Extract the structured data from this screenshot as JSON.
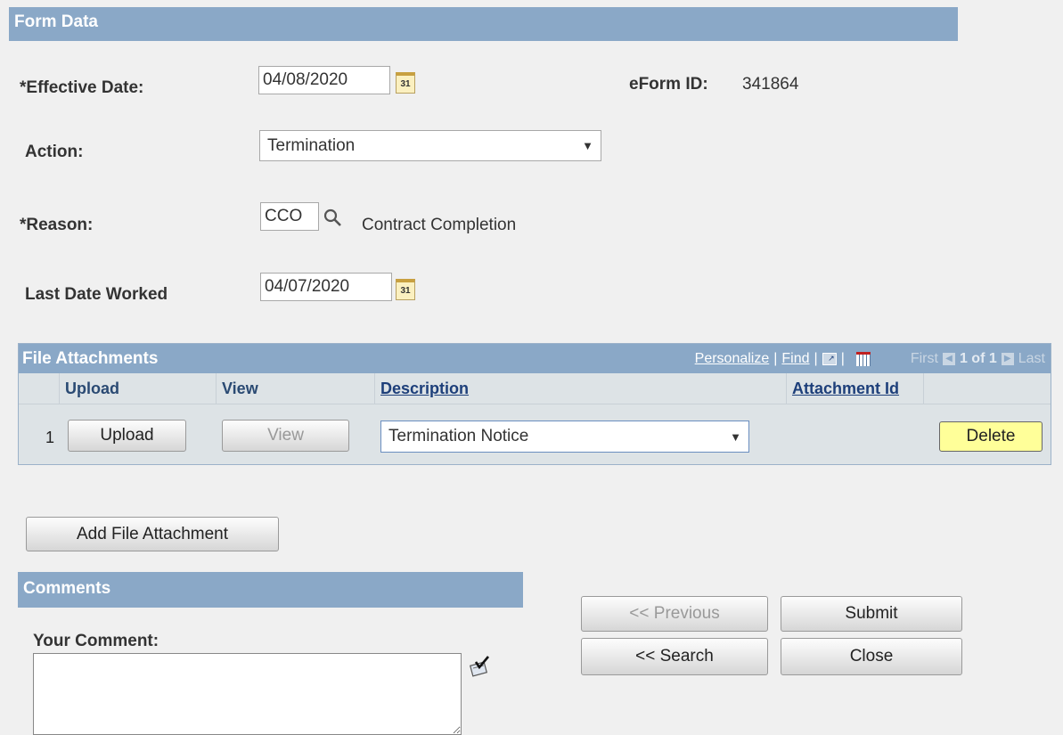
{
  "form": {
    "section_title": "Form Data",
    "effective_date_label": "*Effective Date:",
    "effective_date_value": "04/08/2020",
    "eform_id_label": "eForm ID:",
    "eform_id_value": "341864",
    "action_label": "Action:",
    "action_value": "Termination",
    "reason_label": "*Reason:",
    "reason_code": "CCO",
    "reason_description": "Contract Completion",
    "last_date_label": "Last Date Worked",
    "last_date_value": "04/07/2020",
    "calendar_glyph": "31"
  },
  "attachments": {
    "title": "File Attachments",
    "personalize": "Personalize",
    "find": "Find",
    "separator": "|",
    "first": "First",
    "page_info": "1 of 1",
    "last": "Last",
    "columns": [
      "Upload",
      "View",
      "Description",
      "Attachment Id"
    ],
    "rows": [
      {
        "num": "1",
        "upload_label": "Upload",
        "view_label": "View",
        "description": "Termination Notice",
        "attachment_id": "",
        "delete_label": "Delete"
      }
    ],
    "add_button": "Add File Attachment"
  },
  "comments": {
    "title": "Comments",
    "your_comment_label": "Your Comment:",
    "value": ""
  },
  "actions": {
    "previous": "<< Previous",
    "submit": "Submit",
    "search": "<< Search",
    "close": "Close"
  },
  "colors": {
    "header_bar": "#8aa8c7",
    "delete_button": "#ffff99"
  },
  "icons": {
    "calendar": "calendar-icon",
    "lookup": "magnifier-icon",
    "spellcheck": "spellcheck-icon",
    "zoom": "new-window-icon",
    "download": "download-excel-icon"
  }
}
